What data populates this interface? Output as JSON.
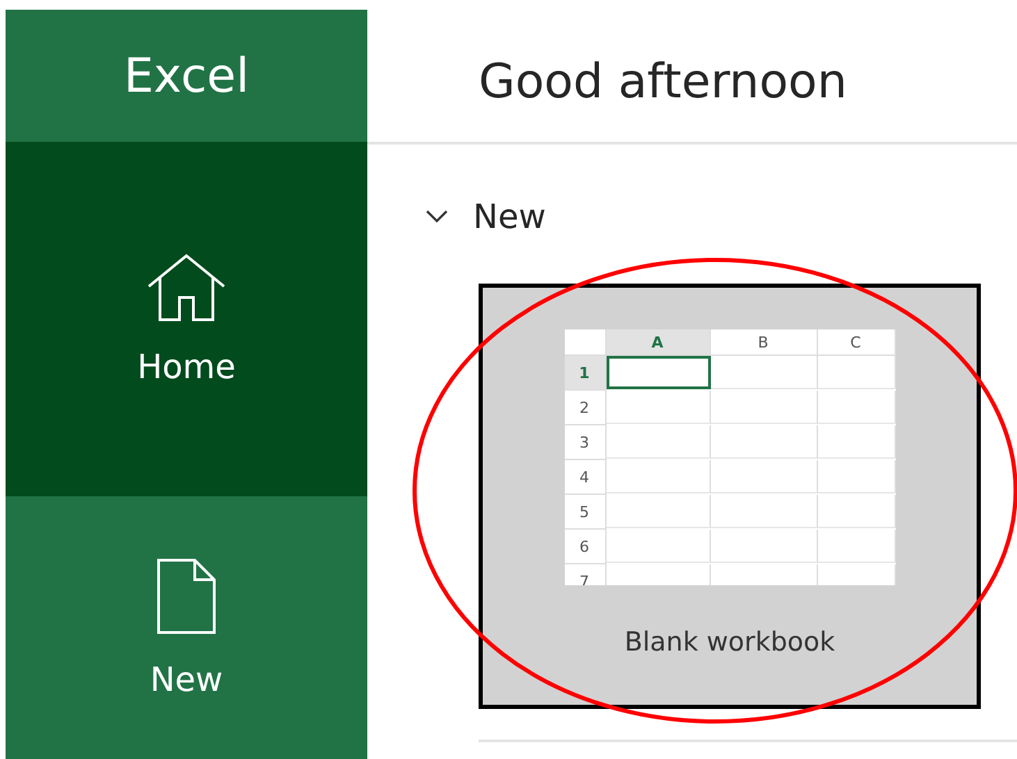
{
  "sidebar": {
    "app_name": "Excel",
    "items": [
      {
        "label": "Home",
        "kind": "home",
        "selected": true
      },
      {
        "label": "New",
        "kind": "document",
        "selected": false
      }
    ]
  },
  "main": {
    "greeting": "Good afternoon",
    "section": {
      "title": "New",
      "expanded": true,
      "templates": [
        {
          "label": "Blank workbook",
          "selected": true,
          "preview": {
            "columns": [
              {
                "label": "A",
                "selected": true
              },
              {
                "label": "B",
                "selected": false
              },
              {
                "label": "C",
                "selected": false
              }
            ],
            "rows": [
              {
                "label": "1",
                "selected": true
              },
              {
                "label": "2",
                "selected": false
              },
              {
                "label": "3",
                "selected": false
              },
              {
                "label": "4",
                "selected": false
              },
              {
                "label": "5",
                "selected": false
              },
              {
                "label": "6",
                "selected": false
              },
              {
                "label": "7",
                "selected": false
              }
            ]
          }
        }
      ]
    }
  },
  "annotation": {
    "kind": "ellipse",
    "color": "#ff0000"
  }
}
